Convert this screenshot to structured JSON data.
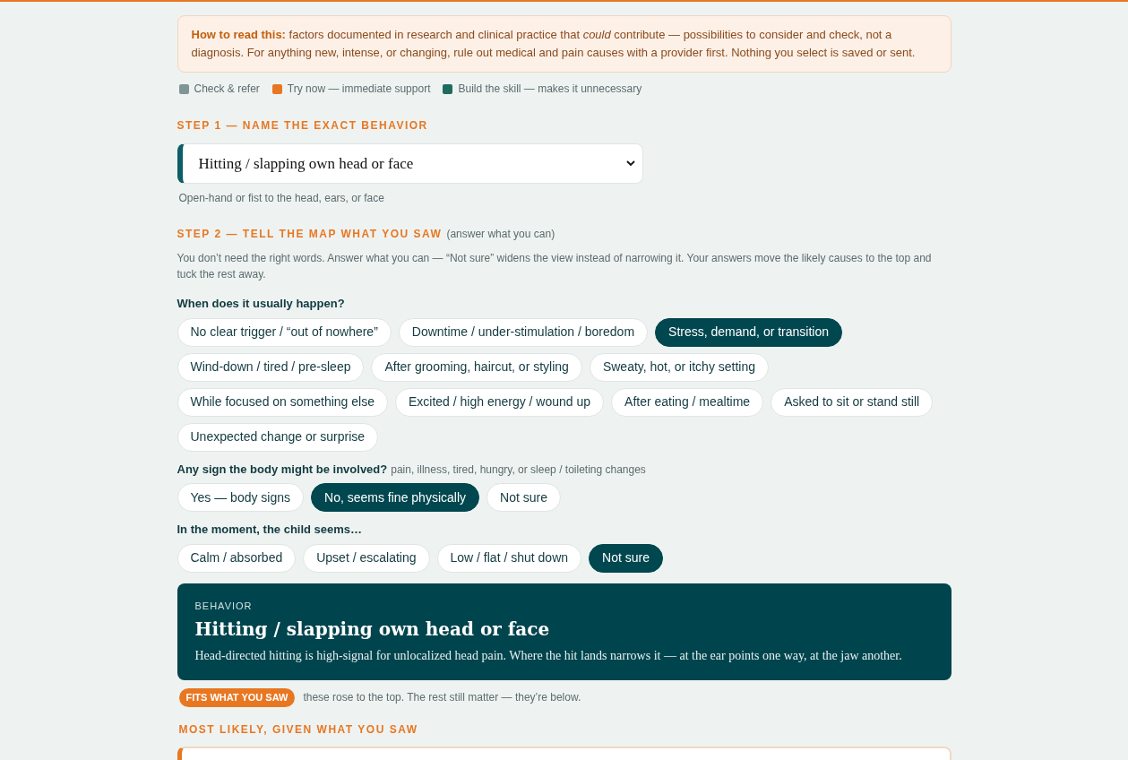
{
  "notice": "**How to read this:** factors documented in research and clinical practice that *could* contribute — possibilities to consider and check, not a diagnosis. For anything new, intense, or changing, rule out medical and pain causes with a provider first. Nothing you select is saved or sent.",
  "legend": [
    {
      "label": "Check & refer",
      "color": "#7f9597"
    },
    {
      "label": "Try now — immediate support",
      "color": "#e87722"
    },
    {
      "label": "Build the skill — makes it unnecessary",
      "color": "#1f6b5e"
    }
  ],
  "step1": {
    "heading": "STEP 1 — NAME THE EXACT BEHAVIOR",
    "value": "Hitting / slapping own head or face",
    "hint": "Open-hand or fist to the head, ears, or face"
  },
  "step2": {
    "heading": "STEP 2 — TELL THE MAP WHAT YOU SAW",
    "note": "(answer what you can)",
    "intro": "You don’t need the right words. Answer what you can — “Not sure” widens the view instead of narrowing it. Your answers move the likely causes to the top and tuck the rest away.",
    "questions": [
      {
        "label": "When does it usually happen?",
        "options": [
          {
            "label": "No clear trigger / “out of nowhere”",
            "selected": false
          },
          {
            "label": "Downtime / under-stimulation / boredom",
            "selected": false
          },
          {
            "label": "Stress, demand, or transition",
            "selected": true
          },
          {
            "label": "Wind-down / tired / pre-sleep",
            "selected": false
          },
          {
            "label": "After grooming, haircut, or styling",
            "selected": false
          },
          {
            "label": "Sweaty, hot, or itchy setting",
            "selected": false
          },
          {
            "label": "While focused on something else",
            "selected": false
          },
          {
            "label": "Excited / high energy / wound up",
            "selected": false
          },
          {
            "label": "After eating / mealtime",
            "selected": false
          },
          {
            "label": "Asked to sit or stand still",
            "selected": false
          },
          {
            "label": "Unexpected change or surprise",
            "selected": false
          }
        ]
      },
      {
        "label": "Any sign the body might be involved?",
        "note": "pain, illness, tired, hungry, or sleep / toileting changes",
        "options": [
          {
            "label": "Yes — body signs",
            "selected": false
          },
          {
            "label": "No, seems fine physically",
            "selected": true
          },
          {
            "label": "Not sure",
            "selected": false
          }
        ]
      },
      {
        "label": "In the moment, the child seems…",
        "options": [
          {
            "label": "Calm / absorbed",
            "selected": false
          },
          {
            "label": "Upset / escalating",
            "selected": false
          },
          {
            "label": "Low / flat / shut down",
            "selected": false
          },
          {
            "label": "Not sure",
            "selected": true
          }
        ]
      }
    ]
  },
  "behavior_card": {
    "eyebrow": "BEHAVIOR",
    "title": "Hitting / slapping own head or face",
    "text": "Head-directed hitting is high-signal for unlocalized head pain. Where the hit lands narrows it — at the ear points one way, at the jaw another."
  },
  "fits": {
    "badge": "FITS WHAT YOU SAW",
    "text": "these rose to the top. The rest still matter — they’re below."
  },
  "most_likely": {
    "heading": "MOST LIKELY, GIVEN WHAT YOU SAW"
  }
}
